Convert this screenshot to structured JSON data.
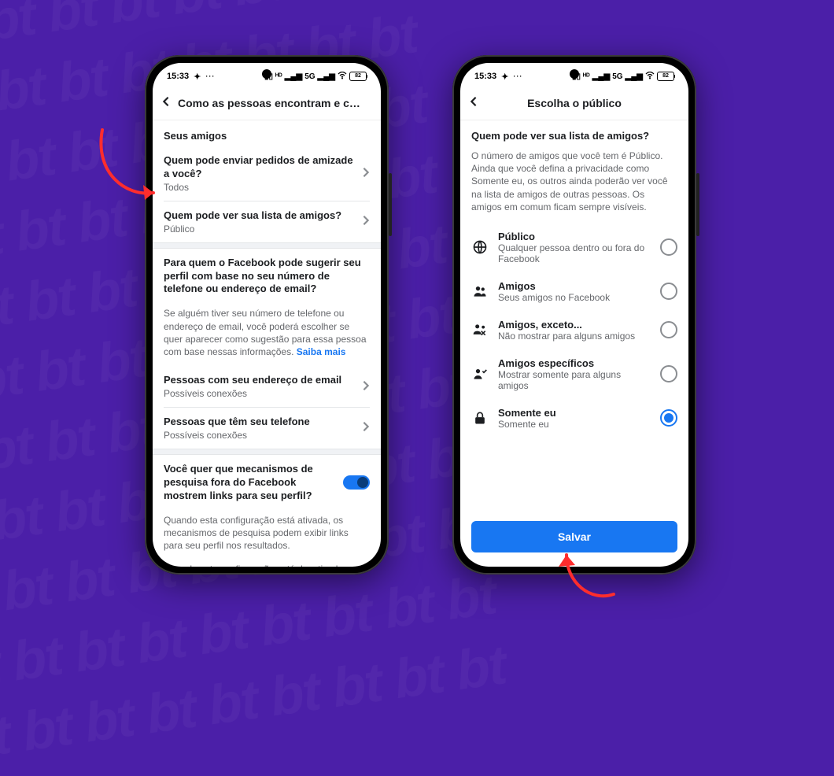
{
  "watermark": "bt bt bt bt bt bt bt bt bt\nbt bt bt bt bt bt bt bt bt\nbt bt bt bt bt bt bt bt bt\nbt bt bt bt bt bt bt bt bt\nbt bt bt bt bt bt bt bt bt\nbt bt bt bt bt bt bt bt bt\nbt bt bt bt bt bt bt bt bt\nbt bt bt bt bt bt bt bt bt\nbt bt bt bt bt bt bt bt bt\nbt bt bt bt bt bt bt bt bt\nbt bt bt bt bt bt bt bt bt",
  "statusbar": {
    "time": "15:33",
    "net": "5G",
    "battery": "82"
  },
  "left": {
    "title": "Como as pessoas encontram e conta…",
    "section1": "Seus amigos",
    "row1": {
      "title": "Quem pode enviar pedidos de amizade a você?",
      "sub": "Todos"
    },
    "row2": {
      "title": "Quem pode ver sua lista de amigos?",
      "sub": "Público"
    },
    "section2_title": "Para quem o Facebook pode sugerir seu perfil com base no seu número de telefone ou endereço de email?",
    "section2_desc": "Se alguém tiver seu número de telefone ou endereço de email, você poderá escolher se quer aparecer como sugestão para essa pessoa com base nessas informações. ",
    "learn_more": "Saiba mais",
    "row3": {
      "title": "Pessoas com seu endereço de email",
      "sub": "Possíveis conexões"
    },
    "row4": {
      "title": "Pessoas que têm seu telefone",
      "sub": "Possíveis conexões"
    },
    "section3_title": "Você quer que mecanismos de pesquisa fora do Facebook mostrem links para seu perfil?",
    "section3_p1": "Quando esta configuração está ativada, os mecanismos de pesquisa podem exibir links para seu perfil nos resultados.",
    "section3_p2": "Quando esta configuração está desativada, os mecanismos de pesquisa param de exibir links para seu perfil, mas isso pode levar algum tempo. Seu perfil ainda poderá ser encontrado no Facebook se as pessoas procurarem seu nome."
  },
  "right": {
    "title": "Escolha o público",
    "question": "Quem pode ver sua lista de amigos?",
    "desc": "O número de amigos que você tem é Público. Ainda que você defina a privacidade como Somente eu, os outros ainda poderão ver você na lista de amigos de outras pessoas. Os amigos em comum ficam sempre visíveis.",
    "options": {
      "public": {
        "title": "Público",
        "sub": "Qualquer pessoa dentro ou fora do Facebook"
      },
      "friends": {
        "title": "Amigos",
        "sub": "Seus amigos no Facebook"
      },
      "except": {
        "title": "Amigos, exceto...",
        "sub": "Não mostrar para alguns amigos"
      },
      "specific": {
        "title": "Amigos específicos",
        "sub": "Mostrar somente para alguns amigos"
      },
      "onlyme": {
        "title": "Somente eu",
        "sub": "Somente eu"
      }
    },
    "save": "Salvar"
  }
}
